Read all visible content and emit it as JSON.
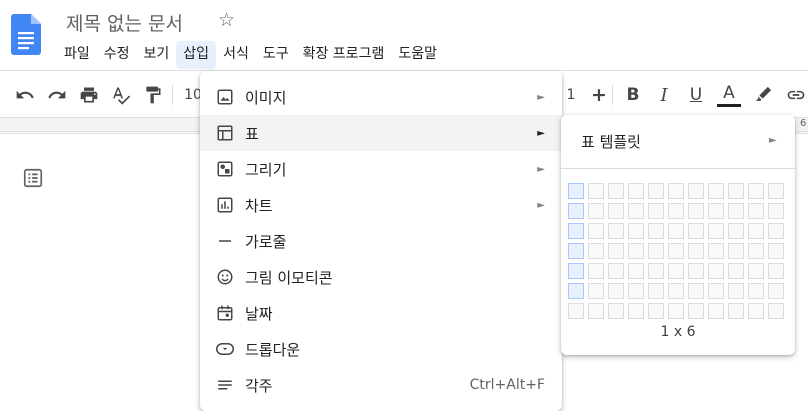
{
  "app": {
    "doc_title": "제목 없는 문서"
  },
  "menubar": {
    "items": [
      "파일",
      "수정",
      "보기",
      "삽입",
      "서식",
      "도구",
      "확장 프로그램",
      "도움말"
    ],
    "active_index": 3
  },
  "toolbar": {
    "zoom_partial": "10",
    "font_size_partial": "1",
    "plus": "+",
    "bold": "B",
    "italic": "I",
    "underline": "U",
    "text_color": "A",
    "text_color_bar": "#202124",
    "ruler_partial": "6"
  },
  "insert_menu": {
    "items": [
      {
        "label": "이미지",
        "icon": "image-icon",
        "submenu": true
      },
      {
        "label": "표",
        "icon": "table-icon",
        "submenu": true,
        "hover": true
      },
      {
        "label": "그리기",
        "icon": "drawing-icon",
        "submenu": true
      },
      {
        "label": "차트",
        "icon": "chart-icon",
        "submenu": true
      },
      {
        "label": "가로줄",
        "icon": "horizontal-line-icon",
        "submenu": false
      },
      {
        "label": "그림 이모티콘",
        "icon": "emoji-icon",
        "submenu": false
      },
      {
        "label": "날짜",
        "icon": "calendar-icon",
        "submenu": false
      },
      {
        "label": "드롭다운",
        "icon": "dropdown-chip-icon",
        "submenu": false
      },
      {
        "label": "각주",
        "icon": "footnote-icon",
        "submenu": false,
        "shortcut": "Ctrl+Alt+F"
      }
    ],
    "submenu_arrow": "►"
  },
  "table_submenu": {
    "templates_label": "표 템플릿",
    "grid_cols": 11,
    "grid_rows": 7,
    "selected_cols": 1,
    "selected_rows": 6,
    "size_label": "1 x 6"
  }
}
